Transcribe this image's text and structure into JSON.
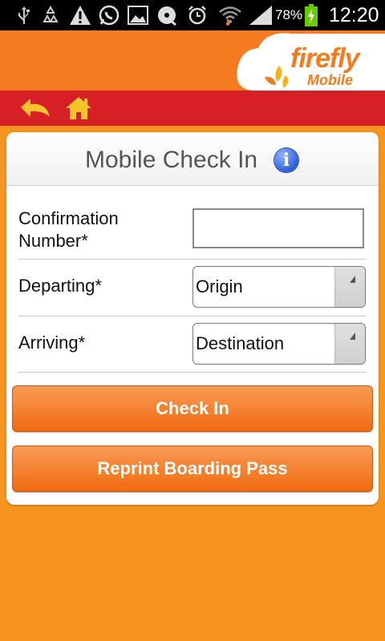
{
  "status_bar": {
    "battery": "78%",
    "time": "12:20",
    "icons": [
      "usb-icon",
      "recycle-icon",
      "warning-icon",
      "whatsapp-icon",
      "image-icon",
      "disc-icon",
      "alarm-icon",
      "wifi-icon",
      "signal-icon",
      "battery-charging-icon"
    ]
  },
  "header": {
    "logo_word": "firefly",
    "logo_sub": "Mobile"
  },
  "nav": {
    "back_icon": "back-arrow-icon",
    "home_icon": "home-icon"
  },
  "card": {
    "title": "Mobile Check In",
    "info_symbol": "i",
    "fields": {
      "confirmation_label_line1": "Confirmation",
      "confirmation_label_line2": "Number*",
      "confirmation_value": "",
      "departing_label": "Departing*",
      "departing_value": "Origin",
      "arriving_label": "Arriving*",
      "arriving_value": "Destination"
    },
    "buttons": {
      "check_in": "Check In",
      "reprint": "Reprint Boarding Pass"
    }
  },
  "colors": {
    "background": "#f7941d",
    "header": "#f47b20",
    "navbar": "#d71f26",
    "nav_icon": "#f7c52b",
    "button": "#f06a10"
  }
}
